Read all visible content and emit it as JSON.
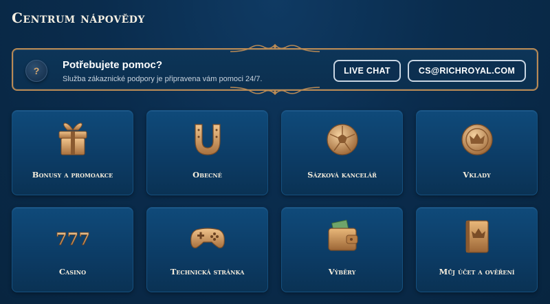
{
  "page": {
    "title": "Centrum nápovědy"
  },
  "banner": {
    "icon": "question-mark-icon",
    "title": "Potřebujete pomoc?",
    "subtitle": "Služba zákaznické podpory je připravena vám pomoci 24/7.",
    "live_chat_label": "LIVE CHAT",
    "email_label": "CS@RICHROYAL.COM"
  },
  "colors": {
    "gold": "#c89a63",
    "tile": "#0f4a7a",
    "background": "#0a2c4d"
  },
  "categories": [
    {
      "label": "Bonusy a promoakce",
      "icon": "gift-icon"
    },
    {
      "label": "Obecné",
      "icon": "horseshoe-icon"
    },
    {
      "label": "Sázková kancelář",
      "icon": "soccer-ball-icon"
    },
    {
      "label": "Vklady",
      "icon": "crown-coin-icon"
    },
    {
      "label": "Casino",
      "icon": "slot-777-icon"
    },
    {
      "label": "Technická stránka",
      "icon": "gamepad-icon"
    },
    {
      "label": "Výběry",
      "icon": "wallet-icon"
    },
    {
      "label": "Můj účet a ověření",
      "icon": "crown-book-icon"
    }
  ]
}
